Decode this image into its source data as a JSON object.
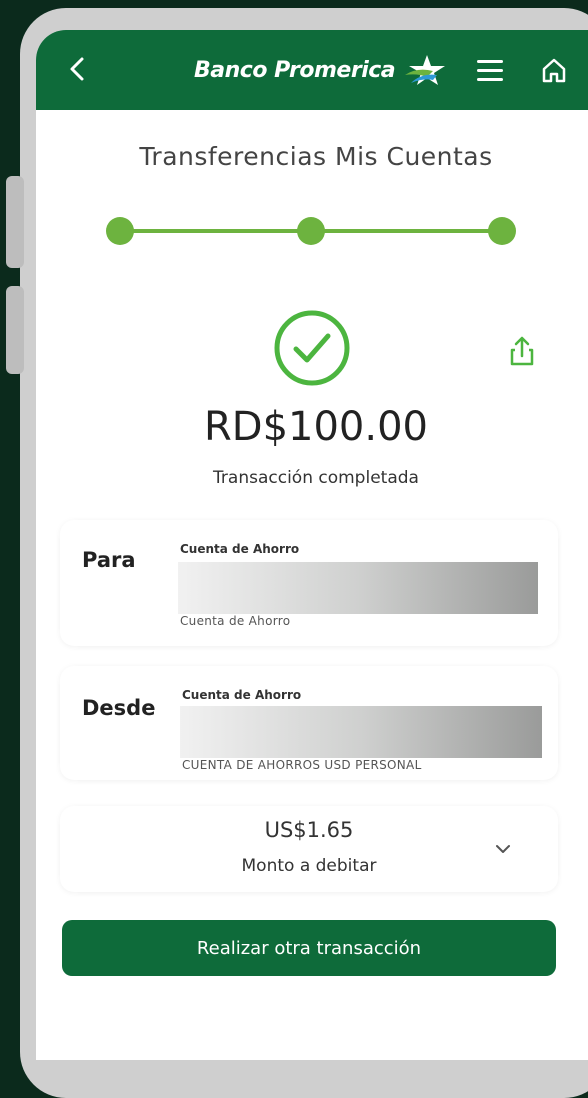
{
  "header": {
    "brand_name": "Banco Promerica",
    "back_icon": "chevron-left-icon",
    "menu_icon": "hamburger-menu-icon",
    "home_icon": "home-icon"
  },
  "page": {
    "title": "Transferencias Mis Cuentas"
  },
  "stepper": {
    "steps_completed": 3,
    "steps_total": 3
  },
  "result": {
    "amount": "RD$100.00",
    "status": "Transacción completada"
  },
  "para": {
    "label": "Para",
    "account_type": "Cuenta de Ahorro",
    "account_subtitle": "Cuenta de Ahorro"
  },
  "desde": {
    "label": "Desde",
    "account_type": "Cuenta de Ahorro",
    "account_subtitle": "CUENTA DE AHORROS USD PERSONAL"
  },
  "debit": {
    "amount": "US$1.65",
    "label": "Monto a debitar"
  },
  "actions": {
    "new_transaction_label": "Realizar otra transacción"
  },
  "colors": {
    "brand_green": "#0e6b3a",
    "accent_green": "#6db33f",
    "background": "#0b2a1c"
  }
}
